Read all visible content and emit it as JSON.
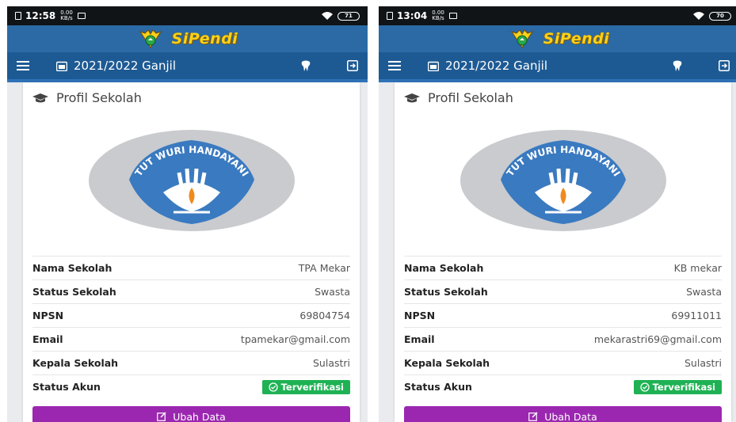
{
  "screens": [
    {
      "status_time": "12:58",
      "status_speed_top": "0.00",
      "status_speed_bottom": "KB/s",
      "battery": "71",
      "app_name": "SiPendi",
      "period": "2021/2022 Ganjil",
      "card_title": "Profil Sekolah",
      "emblem_text": "TUT WURI HANDAYANI",
      "fields": [
        {
          "label": "Nama Sekolah",
          "value": "TPA Mekar"
        },
        {
          "label": "Status Sekolah",
          "value": "Swasta"
        },
        {
          "label": "NPSN",
          "value": "69804754"
        },
        {
          "label": "Email",
          "value": "tpamekar@gmail.com"
        },
        {
          "label": "Kepala Sekolah",
          "value": "Sulastri"
        }
      ],
      "account_status_label": "Status Akun",
      "account_status": "Terverifikasi",
      "edit_label": "Ubah Data"
    },
    {
      "status_time": "13:04",
      "status_speed_top": "0.00",
      "status_speed_bottom": "KB/s",
      "battery": "70",
      "app_name": "SiPendi",
      "period": "2021/2022 Ganjil",
      "card_title": "Profil Sekolah",
      "emblem_text": "TUT WURI HANDAYANI",
      "fields": [
        {
          "label": "Nama Sekolah",
          "value": "KB mekar"
        },
        {
          "label": "Status Sekolah",
          "value": "Swasta"
        },
        {
          "label": "NPSN",
          "value": "69911011"
        },
        {
          "label": "Email",
          "value": "mekarastri69@gmail.com"
        },
        {
          "label": "Kepala Sekolah",
          "value": "Sulastri"
        }
      ],
      "account_status_label": "Status Akun",
      "account_status": "Terverifikasi",
      "edit_label": "Ubah Data"
    }
  ],
  "colors": {
    "appbar": "#2b6aa5",
    "navbar": "#1d5a94",
    "logo_text": "#f7d21b",
    "verified_badge": "#1fb254",
    "edit_button": "#9b27b0"
  }
}
